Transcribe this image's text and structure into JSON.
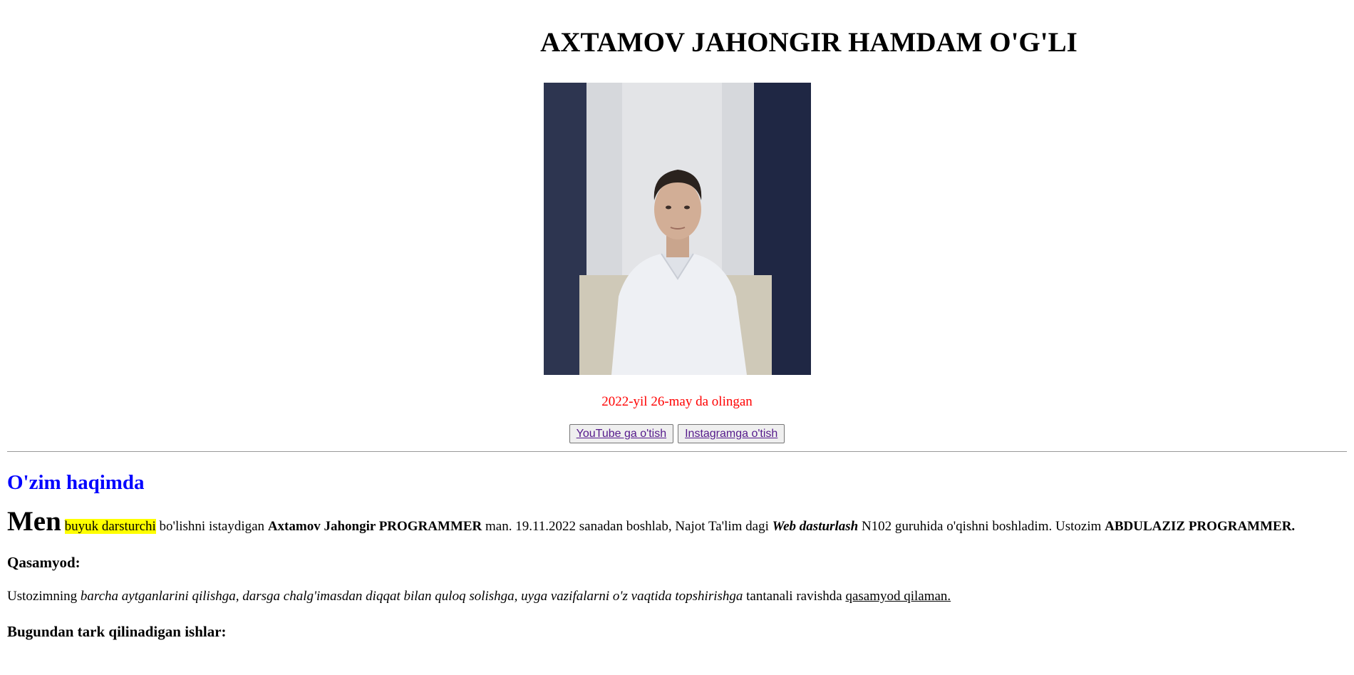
{
  "header": {
    "title": "AXTAMOV JAHONGIR HAMDAM O'G'LI"
  },
  "photo": {
    "caption": "2022-yil 26-may da olingan"
  },
  "links": {
    "youtube_label": "YouTube ga o'tish",
    "instagram_label": "Instagramga o'tish"
  },
  "about": {
    "heading": "O'zim haqimda",
    "big_word": "Men",
    "highlight": "buyuk darsturchi",
    "text1": " bo'lishni istaydigan ",
    "name_bold": "Axtamov Jahongir PROGRAMMER",
    "text2": " man. 19.11.2022 sanadan boshlab, Najot Ta'lim dagi ",
    "course_bold_italic": "Web dasturlash",
    "text3": " N102 guruhida o'qishni boshladim. Ustozim ",
    "teacher_bold": "ABDULAZIZ PROGRAMMER."
  },
  "oath": {
    "heading": "Qasamyod:",
    "text1": "Ustozimning ",
    "italic": "barcha aytganlarini qilishga, darsga chalg'imasdan diqqat bilan quloq solishga, uyga vazifalarni o'z vaqtida topshirishga",
    "text2": " tantanali ravishda ",
    "underlined": "qasamyod qilaman."
  },
  "quit": {
    "heading": "Bugundan tark qilinadigan ishlar:"
  },
  "colors": {
    "caption": "#ff0000",
    "heading_blue": "#0000ff",
    "highlight": "#ffff00",
    "link_visited": "#551a8b"
  }
}
